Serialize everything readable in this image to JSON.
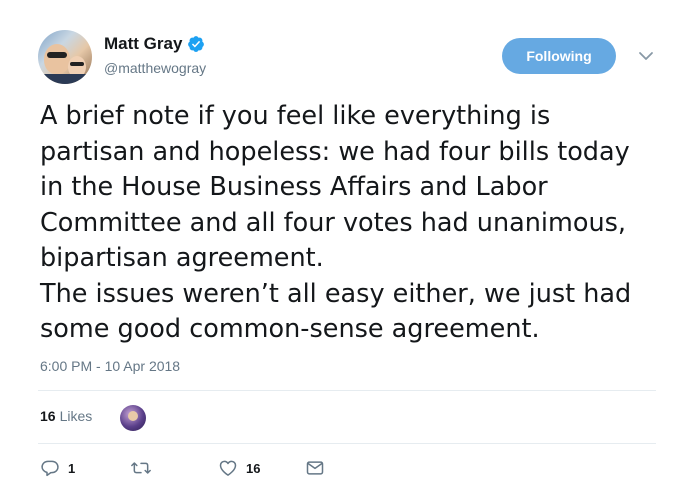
{
  "user": {
    "display_name": "Matt Gray",
    "handle": "@matthewogray",
    "verified": true
  },
  "follow_button": {
    "label": "Following"
  },
  "tweet": {
    "text": "A brief note if you feel like everything is\npartisan and hopeless: we had four bills today\nin the House Business Affairs and Labor\nCommittee and all four votes had unanimous,\nbipartisan agreement.\nThe issues weren’t all easy either, we just had\nsome good common-sense agreement.",
    "timestamp": "6:00 PM - 10 Apr 2018"
  },
  "stats": {
    "likes_count": "16",
    "likes_label": "Likes"
  },
  "actions": {
    "reply_count": "1",
    "retweet_count": "",
    "like_count": "16"
  },
  "colors": {
    "accent": "#66a9e2",
    "verified": "#1da1f2",
    "secondary_text": "#657786",
    "divider": "#e6ecf0"
  },
  "icons": {
    "verified": "verified-badge-icon",
    "caret": "chevron-down-icon",
    "reply": "reply-icon",
    "retweet": "retweet-icon",
    "like": "heart-icon",
    "dm": "envelope-icon"
  }
}
